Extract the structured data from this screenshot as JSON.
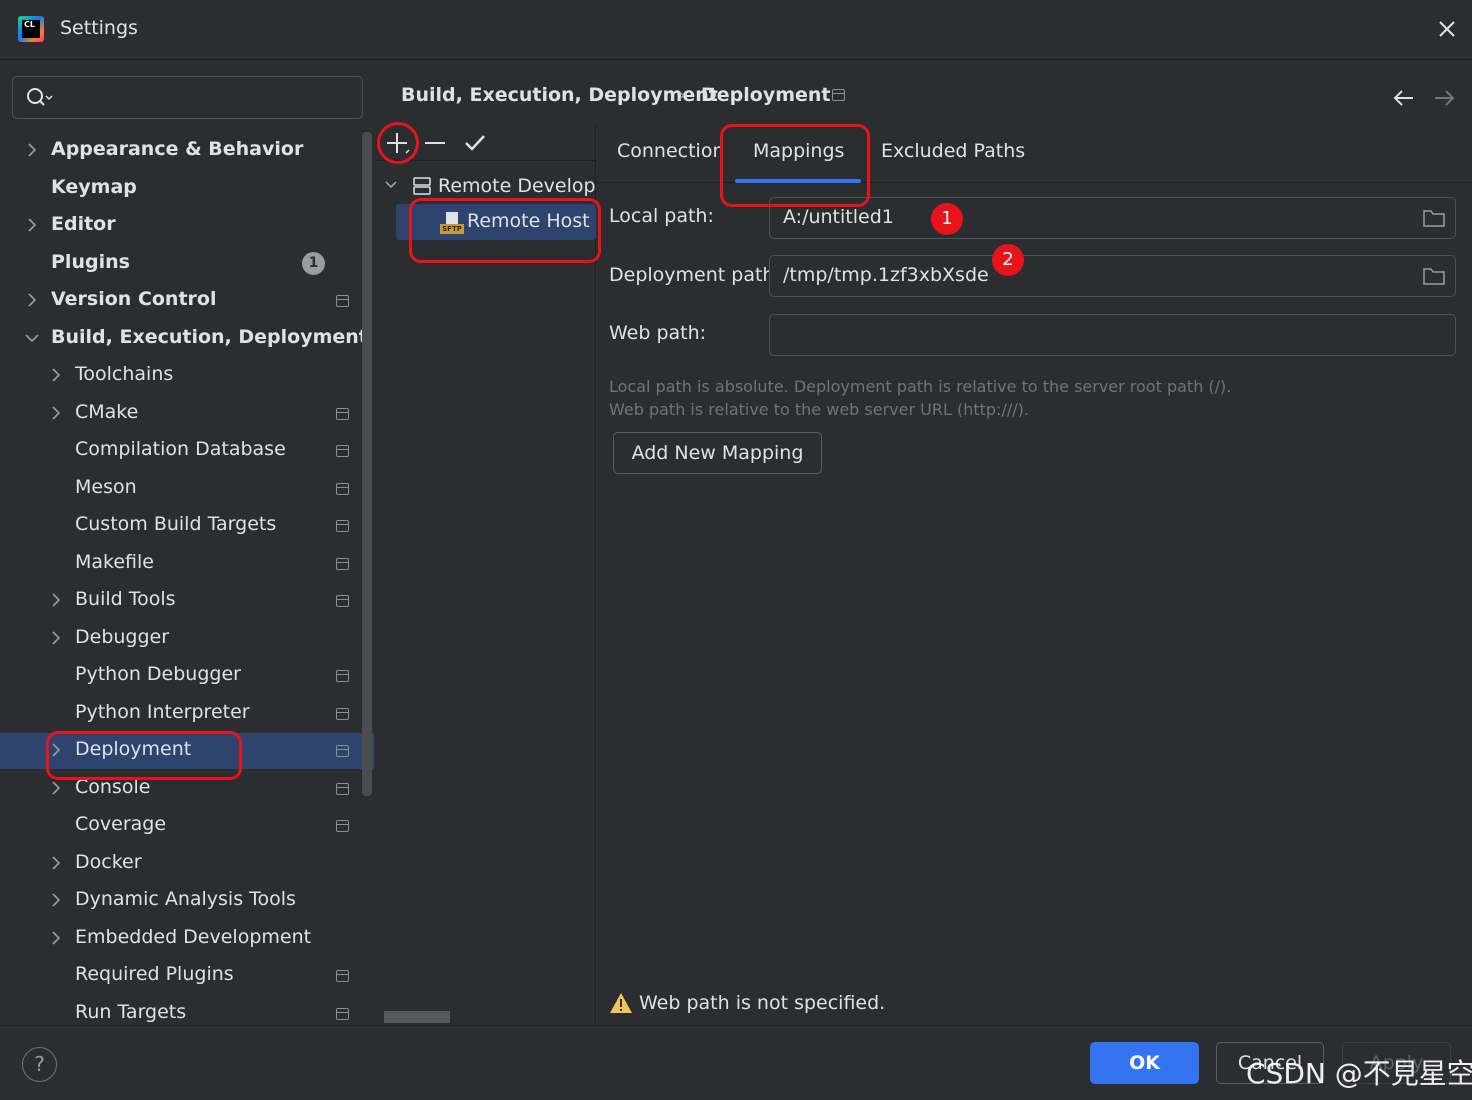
{
  "window": {
    "title": "Settings"
  },
  "search": {
    "placeholder": ""
  },
  "sidebar": {
    "items": [
      {
        "label": "Appearance & Behavior",
        "bold": true,
        "expand": "collapsed",
        "indent": 0,
        "pinned": false
      },
      {
        "label": "Keymap",
        "bold": true,
        "expand": "none",
        "indent": 0,
        "pinned": false
      },
      {
        "label": "Editor",
        "bold": true,
        "expand": "collapsed",
        "indent": 0,
        "pinned": false
      },
      {
        "label": "Plugins",
        "bold": true,
        "expand": "none",
        "indent": 0,
        "pinned": false,
        "badge": "1"
      },
      {
        "label": "Version Control",
        "bold": true,
        "expand": "collapsed",
        "indent": 0,
        "pinned": true
      },
      {
        "label": "Build, Execution, Deployment",
        "bold": true,
        "expand": "expanded",
        "indent": 0,
        "pinned": false
      },
      {
        "label": "Toolchains",
        "bold": false,
        "expand": "collapsed",
        "indent": 1,
        "pinned": false
      },
      {
        "label": "CMake",
        "bold": false,
        "expand": "collapsed",
        "indent": 1,
        "pinned": true
      },
      {
        "label": "Compilation Database",
        "bold": false,
        "expand": "none",
        "indent": 1,
        "pinned": true
      },
      {
        "label": "Meson",
        "bold": false,
        "expand": "none",
        "indent": 1,
        "pinned": true
      },
      {
        "label": "Custom Build Targets",
        "bold": false,
        "expand": "none",
        "indent": 1,
        "pinned": true
      },
      {
        "label": "Makefile",
        "bold": false,
        "expand": "none",
        "indent": 1,
        "pinned": true
      },
      {
        "label": "Build Tools",
        "bold": false,
        "expand": "collapsed",
        "indent": 1,
        "pinned": true
      },
      {
        "label": "Debugger",
        "bold": false,
        "expand": "collapsed",
        "indent": 1,
        "pinned": false
      },
      {
        "label": "Python Debugger",
        "bold": false,
        "expand": "none",
        "indent": 1,
        "pinned": true
      },
      {
        "label": "Python Interpreter",
        "bold": false,
        "expand": "none",
        "indent": 1,
        "pinned": true
      },
      {
        "label": "Deployment",
        "bold": false,
        "expand": "collapsed",
        "indent": 1,
        "pinned": true,
        "selected": true
      },
      {
        "label": "Console",
        "bold": false,
        "expand": "collapsed",
        "indent": 1,
        "pinned": true
      },
      {
        "label": "Coverage",
        "bold": false,
        "expand": "none",
        "indent": 1,
        "pinned": true
      },
      {
        "label": "Docker",
        "bold": false,
        "expand": "collapsed",
        "indent": 1,
        "pinned": false
      },
      {
        "label": "Dynamic Analysis Tools",
        "bold": false,
        "expand": "collapsed",
        "indent": 1,
        "pinned": false
      },
      {
        "label": "Embedded Development",
        "bold": false,
        "expand": "collapsed",
        "indent": 1,
        "pinned": false
      },
      {
        "label": "Required Plugins",
        "bold": false,
        "expand": "none",
        "indent": 1,
        "pinned": true
      },
      {
        "label": "Run Targets",
        "bold": false,
        "expand": "none",
        "indent": 1,
        "pinned": true
      }
    ]
  },
  "breadcrumb": {
    "first": "Build, Execution, Deployment",
    "separator": "›",
    "second": "Deployment"
  },
  "servers": {
    "group_label": "Remote Developm",
    "server_label": "Remote Host C",
    "server_icon_text": "SFTP"
  },
  "tabs": [
    {
      "label": "Connection",
      "active": false
    },
    {
      "label": "Mappings",
      "active": true
    },
    {
      "label": "Excluded Paths",
      "active": false
    }
  ],
  "mapping": {
    "local_path_label": "Local path:",
    "local_path_value": "A:/untitled1",
    "deployment_path_label": "Deployment path:",
    "deployment_path_value": "/tmp/tmp.1zf3xbXsde",
    "web_path_label": "Web path:",
    "web_path_value": "",
    "hint_line1": "Local path is absolute. Deployment path is relative to the server root path (/).",
    "hint_line2": "Web path is relative to the web server URL (http:///).",
    "add_button": "Add New Mapping"
  },
  "annotations": {
    "badge1": "1",
    "badge2": "2",
    "color": "#e8141c"
  },
  "warning": {
    "text": "Web path is not specified."
  },
  "footer": {
    "help": "?",
    "ok": "OK",
    "cancel": "Cancel",
    "apply": "Apply"
  },
  "watermark": "CSDN @不見星空",
  "colors": {
    "background": "#2b2d30",
    "selection": "#2e436e",
    "accent": "#3574f0",
    "text": "#dfe1e5"
  }
}
